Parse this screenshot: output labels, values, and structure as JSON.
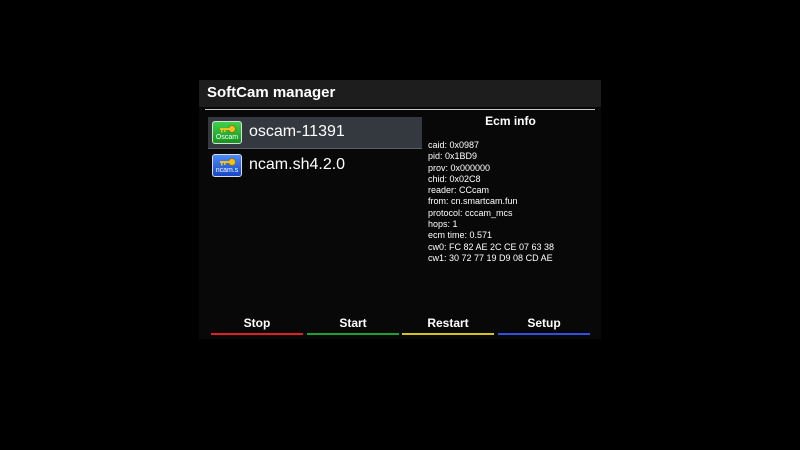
{
  "window": {
    "title": "SoftCam manager"
  },
  "cams": [
    {
      "name": "oscam-11391",
      "icon_label": "Oscam",
      "icon_color": "#22b02e",
      "selected": true
    },
    {
      "name": "ncam.sh4.2.0",
      "icon_label": "ncam.s",
      "icon_color": "#2a5fe6",
      "selected": false
    }
  ],
  "ecm": {
    "title": "Ecm info",
    "lines": [
      "caid: 0x0987",
      "pid: 0x1BD9",
      "prov: 0x000000",
      "chid: 0x02C8",
      "reader: CCcam",
      "from: cn.smartcam.fun",
      "protocol: cccam_mcs",
      "hops: 1",
      "ecm time: 0.571",
      "cw0: FC 82 AE 2C CE 07 63 38",
      "cw1: 30 72 77 19 D9 08 CD AE"
    ]
  },
  "buttons": {
    "stop": {
      "label": "Stop",
      "color": "#e02020"
    },
    "start": {
      "label": "Start",
      "color": "#1ea030"
    },
    "restart": {
      "label": "Restart",
      "color": "#d8c020"
    },
    "setup": {
      "label": "Setup",
      "color": "#3050e0"
    }
  }
}
